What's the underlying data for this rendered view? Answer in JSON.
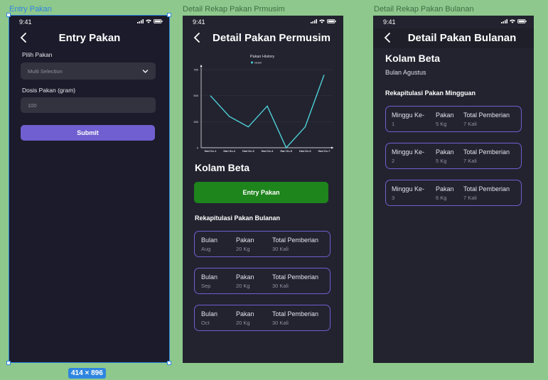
{
  "frames": {
    "entry": {
      "label": "Entry Pakan",
      "dims": "414 × 896"
    },
    "permusim": {
      "label": "Detail Rekap Pakan Prmusim"
    },
    "bulanan": {
      "label": "Detail Rekap Pakan Bulanan"
    }
  },
  "status_time": "9:41",
  "entry": {
    "title": "Entry Pakan",
    "pilih_label": "Pilih Pakan",
    "pilih_value": "Multi Selection",
    "dosis_label": "Dosis Pakan (gram)",
    "dosis_value": "100",
    "submit_label": "Submit"
  },
  "permusim": {
    "title": "Detail Pakan Permusim",
    "kolam": "Kolam Beta",
    "entry_button": "Entry Pakan",
    "rekap_title": "Rekapitulasi Pakan Bulanan",
    "headers": {
      "a": "Bulan",
      "b": "Pakan",
      "c": "Total Pemberian"
    },
    "rows": [
      {
        "a": "Aug",
        "b": "20 Kg",
        "c": "30 Kali"
      },
      {
        "a": "Sep",
        "b": "20 Kg",
        "c": "30 Kali"
      },
      {
        "a": "Oct",
        "b": "20 Kg",
        "c": "30 Kali"
      }
    ]
  },
  "bulanan": {
    "title": "Detail Pakan Bulanan",
    "kolam": "Kolam Beta",
    "bulan": "Bulan Agustus",
    "rekap_title": "Rekapitulasi Pakan Mingguan",
    "headers": {
      "a": "Minggu Ke-",
      "b": "Pakan",
      "c": "Total Pemberian"
    },
    "rows": [
      {
        "a": "1",
        "b": "5 Kg",
        "c": "7 Kali"
      },
      {
        "a": "2",
        "b": "5 Kg",
        "c": "7 Kali"
      },
      {
        "a": "3",
        "b": "6 Kg",
        "c": "7 Kali"
      }
    ]
  },
  "chart_data": {
    "type": "line",
    "title": "Pakan History",
    "series": [
      {
        "name": "Gram",
        "values": [
          500,
          300,
          200,
          400,
          0,
          200,
          700
        ]
      }
    ],
    "categories": [
      "Hari Ke-1",
      "Hari Ke-2",
      "Hari Ke-3",
      "Hari Ke-4",
      "Hari Ke-5",
      "Hari Ke-6",
      "Hari Ke-7"
    ],
    "y_ticks": [
      "0",
      "250",
      "500",
      "750"
    ],
    "ylim": [
      0,
      750
    ],
    "grid": true,
    "legend": "top-center",
    "color": "#4fd1d9"
  }
}
